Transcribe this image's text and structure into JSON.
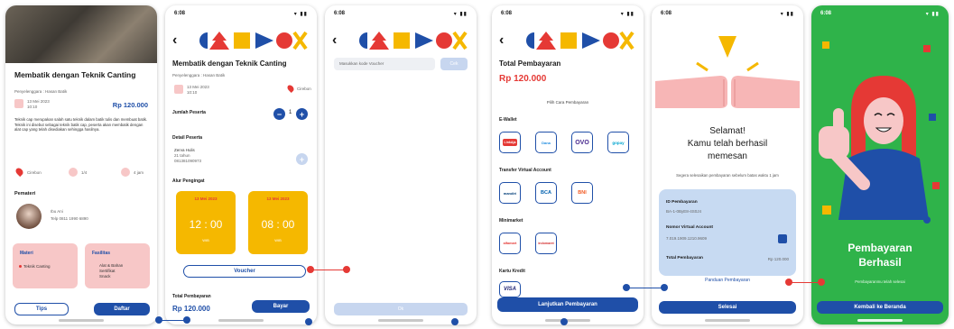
{
  "status": {
    "time": "6:08",
    "signal": "▾ ▮▮"
  },
  "colors": {
    "primary": "#1f4fa8",
    "accent_red": "#e53935",
    "accent_yellow": "#f5b800",
    "pink": "#f7c7c7",
    "success_green": "#2fb34a"
  },
  "screen1": {
    "title": "Membatik dengan Teknik Canting",
    "organizer": "Penyelenggara : Hasan Batik",
    "date": "13 Mei 2023",
    "time": "10:10",
    "price": "Rp 120.000",
    "description": "Teknik cap merupakan salah satu teknik dalam batik tulis dan membuat batik. Teknik ini disebut sebagai teknik batik cap, peserta akan membatik dengan alat cap yang telah disediakan sehingga hasilnya.",
    "info_location": "Cirebon",
    "info_people": "1/4",
    "info_time": "4 jam",
    "mentor_heading": "Pemateri",
    "mentor_name": "Ibu Ani",
    "mentor_phone": "Telp 0811 1990 6890",
    "stock_heading": "Materi",
    "stock_item": "Teknik Canting",
    "facility_heading": "Fasilitas",
    "facility_items": [
      "Alat & Bahan",
      "Sertifikat",
      "Snack"
    ],
    "btn_tips": "Tips",
    "btn_daftar": "Daftar"
  },
  "screen2": {
    "title": "Membatik dengan Teknik Canting",
    "organizer": "Penyelenggara : Hasan Batik",
    "date": "13 Mei 2023",
    "time": "10:10",
    "location": "Cirebon",
    "participants_label": "Jumlah Peserta",
    "participants_value": "1",
    "detail_label": "Detail Peserta",
    "detail_name": "Zerva Hulis",
    "detail_age": "21 tahun",
    "detail_phone": "081381090973",
    "schedule_label": "Alur Pengingat",
    "schedule": [
      {
        "date": "13 Mei 2023",
        "time": "12 : 00",
        "sub": "WIB"
      },
      {
        "date": "13 Mei 2023",
        "time": "08 : 00",
        "sub": "WIB"
      }
    ],
    "voucher": "Voucher",
    "total_label": "Total Pembayaran",
    "total": "Rp 120.000",
    "btn_bayar": "Bayar"
  },
  "screen3": {
    "voucher_placeholder": "Masukkan kode Voucher",
    "btn_cek": "Cek",
    "btn_ok": "Ok"
  },
  "screen4": {
    "total_label": "Total Pembayaran",
    "total": "Rp 120.000",
    "choose_label": "Pilih Cara Pembayaran",
    "ewallet_label": "E-Wallet",
    "ewallet": [
      "LinkAja",
      "Dana",
      "OVO",
      "gopay"
    ],
    "va_label": "Transfer Virtual Account",
    "va": [
      "mandiri",
      "BCA",
      "BNI"
    ],
    "mini_label": "Minimarket",
    "mini": [
      "alfamart",
      "indomaret"
    ],
    "cc_label": "Kartu Kredit",
    "cc": [
      "VISA"
    ],
    "btn_continue": "Lanjutkan Pembayaran"
  },
  "screen5": {
    "heading_line1": "Selamat!",
    "heading_line2": "Kamu telah berhasil",
    "heading_line3": "memesan",
    "sub": "Segera selesaikan pembayaran sebelum batas waktu 1 jam",
    "id_label": "ID Pembayaran",
    "id_value": "BA-1-0ByE8-4S0J4",
    "va_label": "Nomor Virtual Account",
    "va_value": "7.019.1909.1210.9609",
    "total_label": "Total Pembayaran",
    "total_value": "Rp 120.000",
    "guide": "Panduan Pembayaran",
    "btn_done": "Selesai"
  },
  "screen6": {
    "title_line1": "Pembayaran",
    "title_line2": "Berhasil",
    "sub": "Pembayaranmu telah selesai",
    "btn_home": "Kembali ke Beranda"
  }
}
